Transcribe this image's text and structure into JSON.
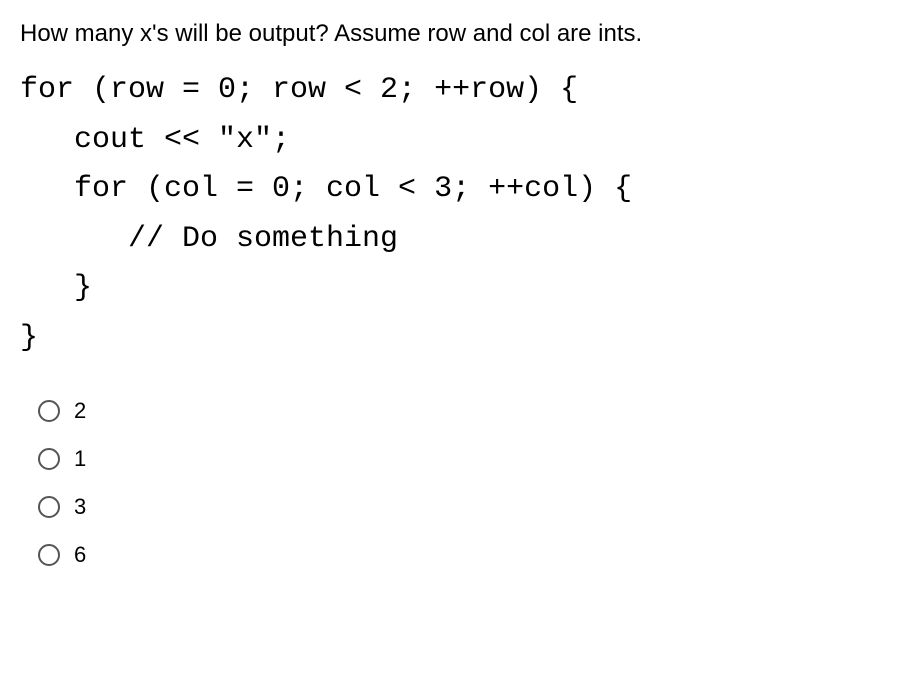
{
  "question": "How many x's will be output? Assume row and col are ints.",
  "code": {
    "line1": "for (row = 0; row < 2; ++row) {",
    "line2": "   cout << \"x\";",
    "line3": "   for (col = 0; col < 3; ++col) {",
    "line4": "      // Do something",
    "line5": "   }",
    "line6": "}"
  },
  "options": [
    {
      "label": "2"
    },
    {
      "label": "1"
    },
    {
      "label": "3"
    },
    {
      "label": "6"
    }
  ]
}
